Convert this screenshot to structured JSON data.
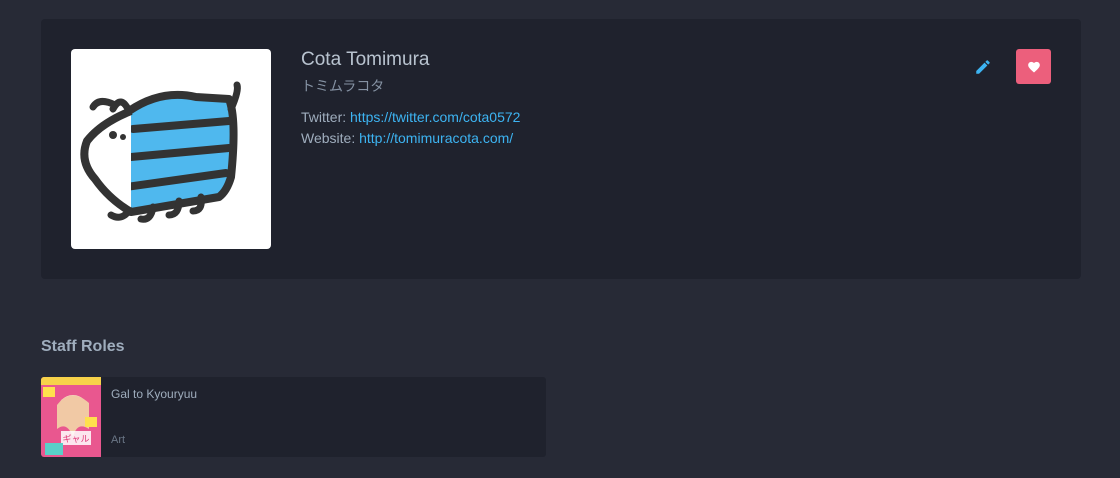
{
  "staff": {
    "name": "Cota Tomimura",
    "native_name": "トミムラコタ",
    "description": {
      "twitter_label": "Twitter: ",
      "twitter_url": "https://twitter.com/cota0572",
      "website_label": "Website: ",
      "website_url": "http://tomimuracota.com/"
    }
  },
  "actions": {
    "edit_icon": "pencil-icon",
    "favourite_icon": "heart-icon"
  },
  "sections": {
    "staff_roles_title": "Staff Roles",
    "roles": [
      {
        "title": "Gal to Kyouryuu",
        "role": "Art"
      }
    ]
  },
  "colors": {
    "background": "#272a36",
    "card": "#1f222d",
    "link": "#3db4f2",
    "favourite": "#ec5f7c"
  }
}
